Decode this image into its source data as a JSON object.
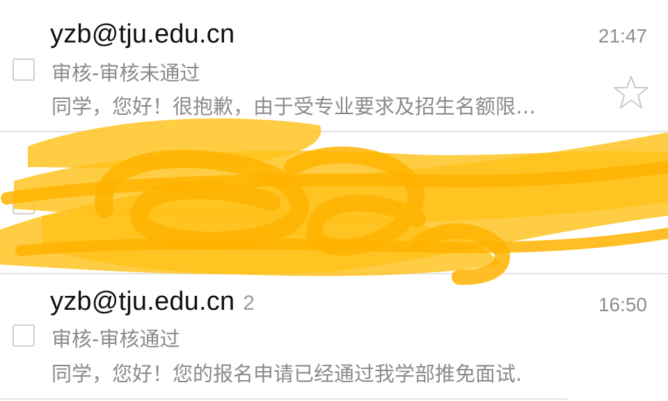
{
  "inbox": {
    "messages": [
      {
        "sender": "yzb@tju.edu.cn",
        "count": "",
        "time": "21:47",
        "subject": "审核-审核未通过",
        "preview": "同学，您好！很抱歉，由于受专业要求及招生名额限…",
        "starred": false
      },
      {
        "sender": "yzb@tju.edu.cn",
        "count": "2",
        "time": "16:50",
        "subject": "审核-审核通过",
        "preview": "同学，您好！您的报名申请已经通过我学部推免面试."
      }
    ]
  },
  "redaction": {
    "color": "#FFC21A"
  }
}
